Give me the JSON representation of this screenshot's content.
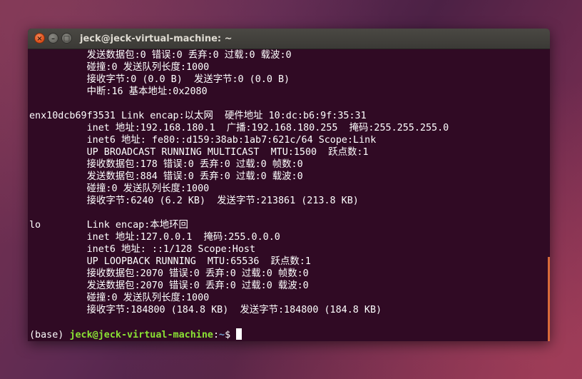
{
  "window": {
    "title": "jeck@jeck-virtual-machine: ~",
    "close_glyph": "×",
    "minimize_glyph": "–",
    "maximize_glyph": "□"
  },
  "terminal": {
    "lines": [
      "          发送数据包:0 错误:0 丢弃:0 过载:0 载波:0",
      "          碰撞:0 发送队列长度:1000",
      "          接收字节:0 (0.0 B)  发送字节:0 (0.0 B)",
      "          中断:16 基本地址:0x2080",
      "",
      "enx10dcb69f3531 Link encap:以太网  硬件地址 10:dc:b6:9f:35:31",
      "          inet 地址:192.168.180.1  广播:192.168.180.255  掩码:255.255.255.0",
      "          inet6 地址: fe80::d159:38ab:1ab7:621c/64 Scope:Link",
      "          UP BROADCAST RUNNING MULTICAST  MTU:1500  跃点数:1",
      "          接收数据包:178 错误:0 丢弃:0 过载:0 帧数:0",
      "          发送数据包:884 错误:0 丢弃:0 过载:0 载波:0",
      "          碰撞:0 发送队列长度:1000",
      "          接收字节:6240 (6.2 KB)  发送字节:213861 (213.8 KB)",
      "",
      "lo        Link encap:本地环回",
      "          inet 地址:127.0.0.1  掩码:255.0.0.0",
      "          inet6 地址: ::1/128 Scope:Host",
      "          UP LOOPBACK RUNNING  MTU:65536  跃点数:1",
      "          接收数据包:2070 错误:0 丢弃:0 过载:0 帧数:0",
      "          发送数据包:2070 错误:0 丢弃:0 过载:0 载波:0",
      "          碰撞:0 发送队列长度:1000",
      "          接收字节:184800 (184.8 KB)  发送字节:184800 (184.8 KB)",
      ""
    ],
    "prompt": {
      "env": "(base) ",
      "user_host": "jeck@jeck-virtual-machine",
      "separator": ":",
      "path": "~",
      "symbol": "$ "
    }
  },
  "colors": {
    "terminal_bg": "#300a24",
    "prompt_user": "#8ae234",
    "prompt_path": "#729fcf",
    "close_button": "#e0541e"
  }
}
